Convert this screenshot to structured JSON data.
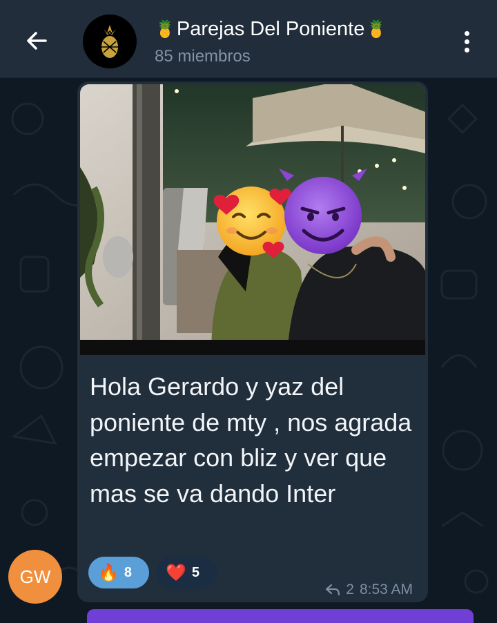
{
  "header": {
    "title": "Parejas Del Poniente",
    "title_emoji": "🍍",
    "subtitle": "85 miembros"
  },
  "message": {
    "text": "Hola Gerardo y yaz del poniente de mty , nos agrada empezar con bliz y ver que mas se va dando Inter",
    "photo_emojis": {
      "left": "🥰",
      "right": "😈"
    },
    "reactions": [
      {
        "emoji": "🔥",
        "count": "8"
      },
      {
        "emoji": "❤️",
        "count": "5"
      }
    ],
    "replies": "2",
    "time": "8:53 AM"
  },
  "sender": {
    "initials": "GW"
  },
  "colors": {
    "header_bg": "#212d3b",
    "chat_bg": "#0f1923",
    "bubble_bg": "#212e3c",
    "reaction_active": "#5a9fd8",
    "avatar_orange": "#f0903e"
  }
}
